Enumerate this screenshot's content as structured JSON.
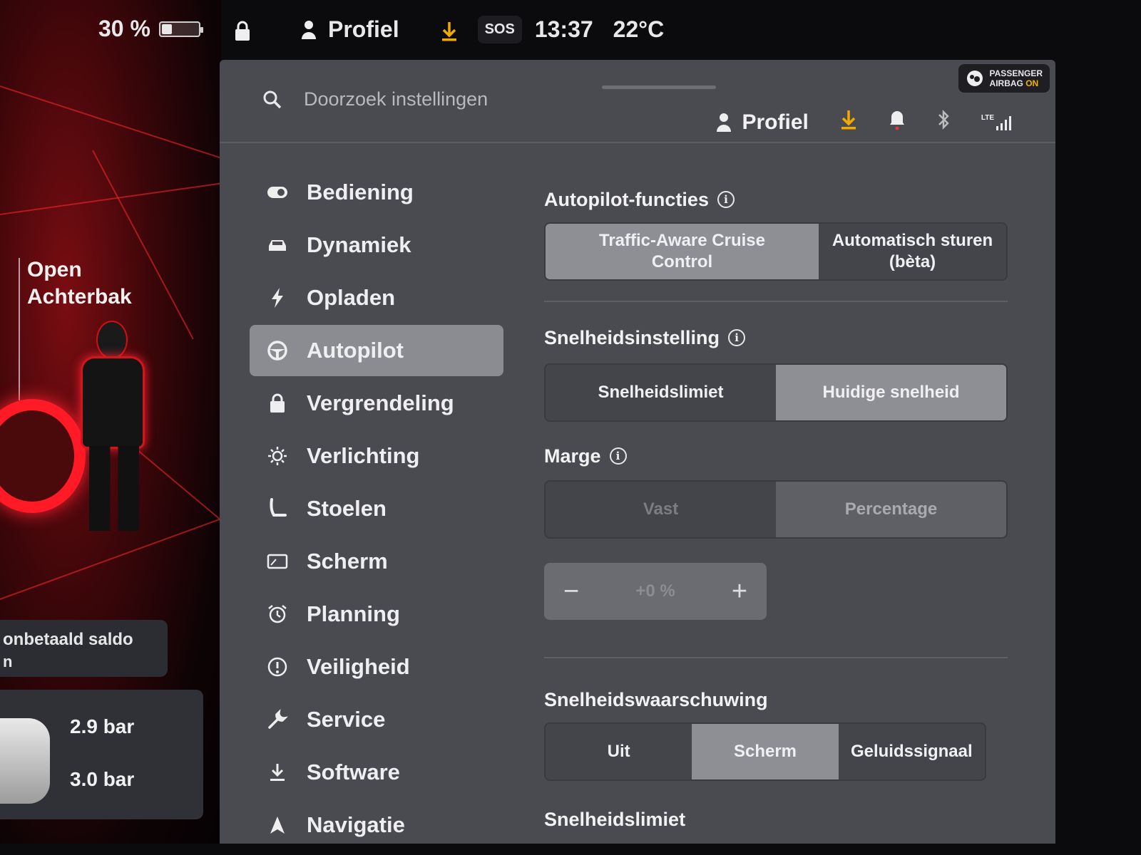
{
  "status": {
    "battery_percent": "30 %",
    "battery_level": 0.3,
    "profile": "Profiel",
    "sos": "SOS",
    "time": "13:37",
    "temperature": "22°C",
    "airbag_line1": "PASSENGER",
    "airbag_line2": "AIRBAG",
    "airbag_state": "ON",
    "lte": "LTE"
  },
  "car": {
    "trunk_label_1": "Open",
    "trunk_label_2": "Achterbak",
    "saldo_label": "onbetaald saldo",
    "saldo_sub": "n",
    "tire_front": "2.9 bar",
    "tire_rear": "3.0 bar"
  },
  "search": {
    "placeholder": "Doorzoek instellingen"
  },
  "header": {
    "profile_label": "Profiel"
  },
  "sidebar": {
    "items": [
      {
        "label": "Bediening",
        "icon": "toggle-icon"
      },
      {
        "label": "Dynamiek",
        "icon": "car-icon"
      },
      {
        "label": "Opladen",
        "icon": "bolt-icon"
      },
      {
        "label": "Autopilot",
        "icon": "steering-wheel-icon",
        "active": true
      },
      {
        "label": "Vergrendeling",
        "icon": "lock-icon"
      },
      {
        "label": "Verlichting",
        "icon": "sun-icon"
      },
      {
        "label": "Stoelen",
        "icon": "seat-icon"
      },
      {
        "label": "Scherm",
        "icon": "display-icon"
      },
      {
        "label": "Planning",
        "icon": "alarm-clock-icon"
      },
      {
        "label": "Veiligheid",
        "icon": "alert-circle-icon"
      },
      {
        "label": "Service",
        "icon": "wrench-icon"
      },
      {
        "label": "Software",
        "icon": "download-icon"
      },
      {
        "label": "Navigatie",
        "icon": "navigation-icon"
      }
    ]
  },
  "autopilot": {
    "features_title": "Autopilot-functies",
    "features_options": [
      "Traffic-Aware Cruise Control",
      "Automatisch sturen (bèta)"
    ],
    "features_selected": 0,
    "speed_setting_title": "Snelheidsinstelling",
    "speed_setting_options": [
      "Snelheidslimiet",
      "Huidige snelheid"
    ],
    "speed_setting_selected": 1,
    "margin_title": "Marge",
    "margin_options": [
      "Vast",
      "Percentage"
    ],
    "margin_selected": 1,
    "offset_value": "+0 %",
    "offset_minus": "−",
    "offset_plus": "+",
    "warning_title": "Snelheidswaarschuwing",
    "warning_options": [
      "Uit",
      "Scherm",
      "Geluidssignaal"
    ],
    "warning_selected": 1,
    "speed_limit_title": "Snelheidslimiet"
  },
  "colors": {
    "accent_download": "#f2a900",
    "notification_dot": "#e0383e"
  }
}
